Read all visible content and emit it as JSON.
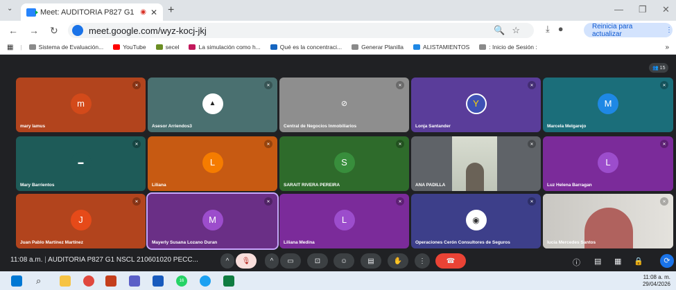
{
  "browser": {
    "tab_title": "Meet: AUDITORIA P827 G1 NS",
    "url": "meet.google.com/wyz-kocj-jkj",
    "update_label": "Reinicia para actualizar",
    "bookmarks": [
      {
        "label": "Sistema de Evaluación...",
        "color": "#8a8a8a"
      },
      {
        "label": "YouTube",
        "color": "#ff0000"
      },
      {
        "label": "secel",
        "color": "#6b8e23"
      },
      {
        "label": "La simulación como h...",
        "color": "#c2185b"
      },
      {
        "label": "Qué es la concentraci...",
        "color": "#1565c0"
      },
      {
        "label": "Generar Planilla",
        "color": "#8a8a8a"
      },
      {
        "label": "ALISTAMIENTOS",
        "color": "#1e88e5"
      },
      {
        "label": ": Inicio de Sesión :",
        "color": "#8a8a8a"
      }
    ]
  },
  "meet": {
    "people_count": "15",
    "time": "11:08 a.m.",
    "meeting_title": "AUDITORIA P827 G1 NSCL 210601020 PECC...",
    "participants": [
      {
        "name": "mary lamus",
        "initial": "m",
        "bg": "#b2441d",
        "av": "#d34a1a"
      },
      {
        "name": "Asesor Arriendos3",
        "initial": "",
        "bg": "#4a7070",
        "av": "#ffffff"
      },
      {
        "name": "Central de Negocios Inmobiliarios",
        "initial": "",
        "bg": "#8e8e8e",
        "av": "#8e8e8e"
      },
      {
        "name": "Lonja Santander",
        "initial": "",
        "bg": "#5a3d9a",
        "av": "#3f51b5"
      },
      {
        "name": "Marcela Melgarejo",
        "initial": "M",
        "bg": "#1b6e7a",
        "av": "#1e88e5"
      },
      {
        "name": "Mary Barrientos",
        "initial": "",
        "bg": "#1e5b58",
        "av": "#1e5b58"
      },
      {
        "name": "Liliana",
        "initial": "L",
        "bg": "#c75a12",
        "av": "#f57c00"
      },
      {
        "name": "SARAIT RIVERA PEREIRA",
        "initial": "S",
        "bg": "#2e6b2b",
        "av": "#388e3c"
      },
      {
        "name": "ANA PADILLA",
        "initial": "",
        "bg": "#5f6368",
        "av": ""
      },
      {
        "name": "Luz Helena Barragan",
        "initial": "L",
        "bg": "#7b2b9a",
        "av": "#9c4dcc"
      },
      {
        "name": "Juan Pablo Martínez Martínez",
        "initial": "J",
        "bg": "#b2441d",
        "av": "#e64a19"
      },
      {
        "name": "Mayerly Susana Lozano Duran",
        "initial": "M",
        "bg": "#6a2f86",
        "av": "#9c4dcc"
      },
      {
        "name": "Liliana Medina",
        "initial": "L",
        "bg": "#7b2b9a",
        "av": "#9c4dcc"
      },
      {
        "name": "Operaciones Cerón Consultores de Seguros",
        "initial": "",
        "bg": "#3d3f8a",
        "av": "#ffffff"
      },
      {
        "name": "lucia Mercedes Santos",
        "initial": "",
        "bg": "#cfcac2",
        "av": ""
      }
    ]
  },
  "taskbar": {
    "time": "11:08 a. m.",
    "date": "29/04/2026",
    "badge": "16"
  }
}
